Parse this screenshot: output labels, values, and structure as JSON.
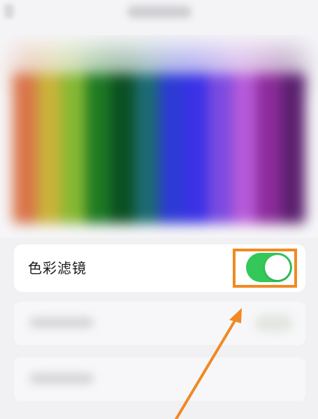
{
  "settings": {
    "color_filters_label": "色彩滤镜",
    "color_filters_on": true
  },
  "colors": {
    "toggle_on": "#34c759",
    "highlight": "#f08a24"
  },
  "preview": {
    "bands": [
      "#d9754a",
      "#c9b33a",
      "#86b833",
      "#1e7a22",
      "#0a4f22",
      "#1c6b72",
      "#2c3bd4",
      "#3a31e6",
      "#7b4be0",
      "#b65ad9",
      "#8c2b9a",
      "#5a206e"
    ]
  },
  "icons": {
    "annotation": "arrow-pointer-icon"
  }
}
